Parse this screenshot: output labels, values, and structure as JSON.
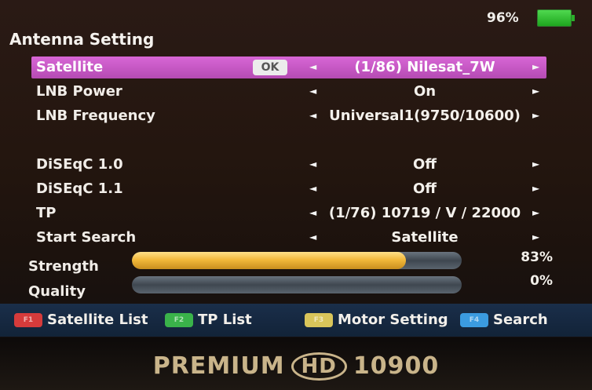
{
  "status": {
    "battery_percent": "96%",
    "battery_level": 0.96
  },
  "title": "Antenna Setting",
  "menu": {
    "ok_label": "OK",
    "rows": [
      {
        "label": "Satellite",
        "value": "(1/86) Nilesat_7W"
      },
      {
        "label": "LNB Power",
        "value": "On"
      },
      {
        "label": "LNB Frequency",
        "value": "Universal1(9750/10600)"
      },
      {
        "label": "DiSEqC 1.0",
        "value": "Off"
      },
      {
        "label": "DiSEqC 1.1",
        "value": "Off"
      },
      {
        "label": "TP",
        "value": "(1/76) 10719 / V / 22000"
      },
      {
        "label": "Start Search",
        "value": "Satellite"
      }
    ]
  },
  "meters": {
    "strength": {
      "label": "Strength",
      "percent_text": "83%",
      "value": 0.83
    },
    "quality": {
      "label": "Quality",
      "percent_text": "0%",
      "value": 0.0
    }
  },
  "footer": {
    "red": {
      "key": "F1",
      "label": "Satellite List",
      "color": "#d63b3b"
    },
    "green": {
      "key": "F2",
      "label": "TP List",
      "color": "#3ab34a"
    },
    "yellow": {
      "key": "F3",
      "label": "Motor Setting",
      "color": "#d9c55a"
    },
    "blue": {
      "key": "F4",
      "label": "Search",
      "color": "#3b9be0"
    }
  },
  "bezel": {
    "brand_left": "PREMIUM",
    "brand_logo": "HD",
    "brand_right": "10900"
  },
  "colors": {
    "selection": "#c85ac6",
    "strength_fill": "#f2b93b",
    "footer_bg": "#1a2e4a",
    "battery": "#2ab02a"
  }
}
